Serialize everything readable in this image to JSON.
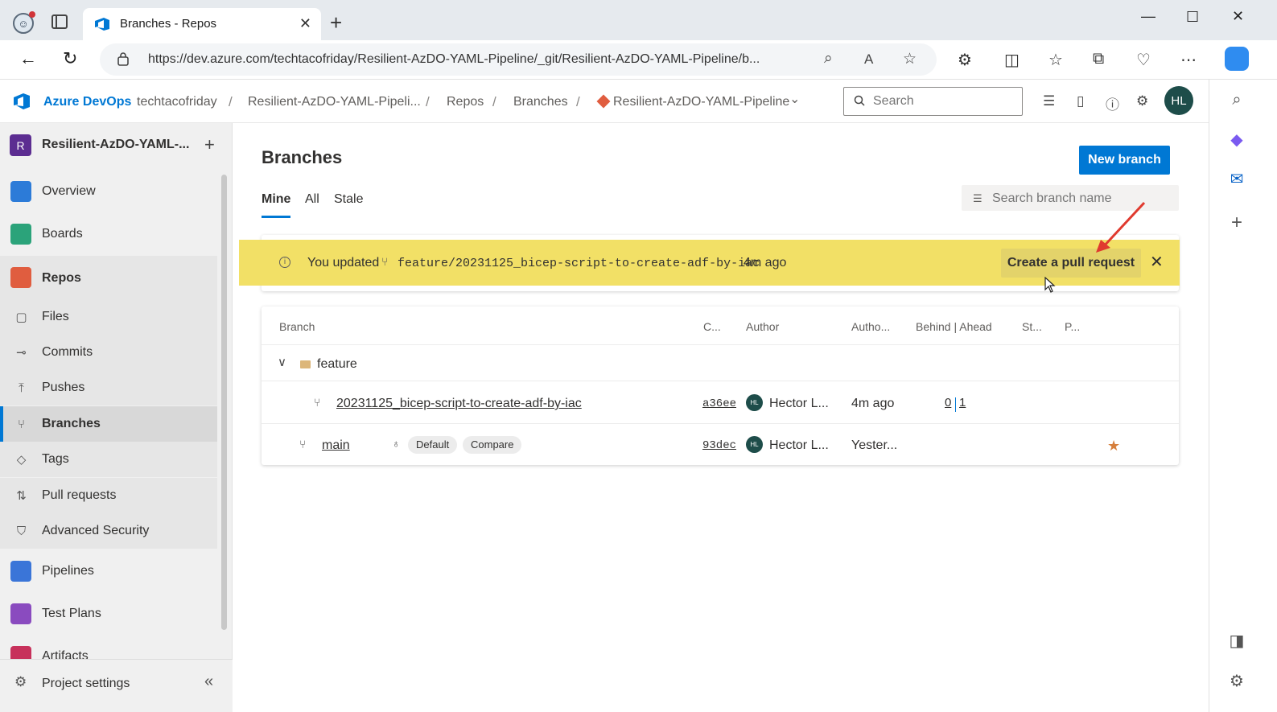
{
  "browser": {
    "tab_title": "Branches - Repos",
    "url": "https://dev.azure.com/techtacofriday/Resilient-AzDO-YAML-Pipeline/_git/Resilient-AzDO-YAML-Pipeline/b..."
  },
  "header": {
    "brand": "Azure DevOps",
    "org": "techtacofriday",
    "project_crumb": "Resilient-AzDO-YAML-Pipeli...",
    "repos_crumb": "Repos",
    "branches_crumb": "Branches",
    "repo_crumb": "Resilient-AzDO-YAML-Pipeline",
    "search_placeholder": "Search",
    "avatar_initials": "HL"
  },
  "sidebar": {
    "project_badge": "R",
    "project_name": "Resilient-AzDO-YAML-...",
    "items": [
      {
        "label": "Overview"
      },
      {
        "label": "Boards"
      },
      {
        "label": "Repos"
      },
      {
        "label": "Pipelines"
      },
      {
        "label": "Test Plans"
      },
      {
        "label": "Artifacts"
      }
    ],
    "repos_sub": [
      {
        "label": "Files"
      },
      {
        "label": "Commits"
      },
      {
        "label": "Pushes"
      },
      {
        "label": "Branches"
      },
      {
        "label": "Tags"
      },
      {
        "label": "Pull requests"
      },
      {
        "label": "Advanced Security"
      }
    ],
    "project_settings": "Project settings"
  },
  "main": {
    "title": "Branches",
    "new_branch_label": "New branch",
    "pivots": [
      "Mine",
      "All",
      "Stale"
    ],
    "filter_placeholder": "Search branch name",
    "banner": {
      "prefix": "You updated",
      "branch": "feature/20231125_bicep-script-to-create-adf-by-iac",
      "suffix": "4m ago",
      "cta": "Create a pull request"
    },
    "table": {
      "columns": [
        "Branch",
        "C...",
        "Author",
        "Autho...",
        "Behind | Ahead",
        "St...",
        "P..."
      ],
      "group": "feature",
      "rows": [
        {
          "branch": "20231125_bicep-script-to-create-adf-by-iac",
          "commit": "a36ee",
          "author_initials": "HL",
          "author": "Hector L...",
          "authored": "4m ago",
          "behind": "0",
          "ahead": "1"
        },
        {
          "branch": "main",
          "commit": "93dec",
          "author_initials": "HL",
          "author": "Hector L...",
          "authored": "Yester...",
          "badge_default": "Default",
          "badge_compare": "Compare"
        }
      ]
    }
  },
  "colors": {
    "accent": "#0078d4",
    "banner": "#f2e066",
    "avatar": "#1e4d4a",
    "project_badge": "#5c2d91"
  }
}
